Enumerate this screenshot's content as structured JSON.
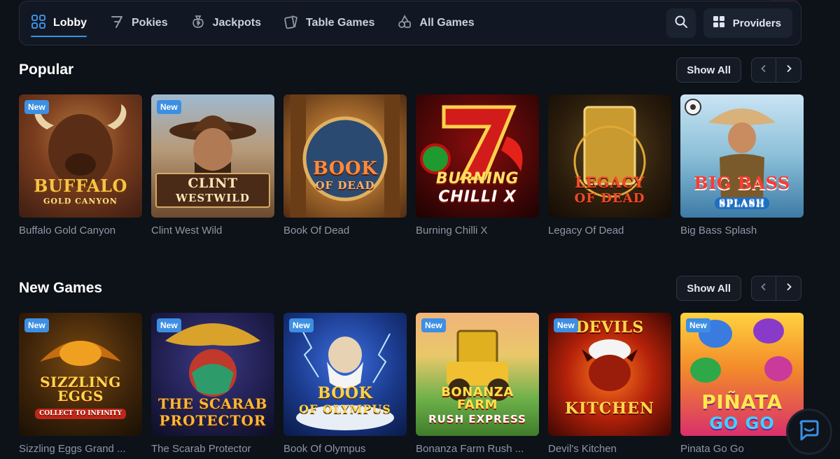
{
  "nav": {
    "tabs": [
      {
        "label": "Lobby",
        "icon": "grid-icon",
        "active": true
      },
      {
        "label": "Pokies",
        "icon": "seven-icon",
        "active": false
      },
      {
        "label": "Jackpots",
        "icon": "money-bag-icon",
        "active": false
      },
      {
        "label": "Table Games",
        "icon": "cards-icon",
        "active": false
      },
      {
        "label": "All Games",
        "icon": "cherries-icon",
        "active": false
      }
    ],
    "search_icon": "search-icon",
    "providers_label": "Providers",
    "providers_icon": "grid-icon"
  },
  "colors": {
    "background": "#0d1118",
    "accent": "#3d8fe3",
    "muted_text": "#8e98a6"
  },
  "sections": [
    {
      "title": "Popular",
      "show_all_label": "Show All",
      "games": [
        {
          "name": "Buffalo Gold Canyon",
          "badge": "New",
          "logo_line1": "BUFFALO",
          "logo_line2": "GOLD CANYON"
        },
        {
          "name": "Clint West Wild",
          "badge": "New",
          "logo_line1": "CLINT",
          "logo_line2": "WESTWILD"
        },
        {
          "name": "Book Of Dead",
          "badge": "",
          "logo_line1": "BOOK",
          "logo_line2": "OF DEAD"
        },
        {
          "name": "Burning Chilli X",
          "badge": "",
          "logo_line1": "BURNING",
          "logo_line2": "CHILLI X"
        },
        {
          "name": "Legacy Of Dead",
          "badge": "",
          "logo_line1": "LEGACY",
          "logo_line2": "OF DEAD"
        },
        {
          "name": "Big Bass Splash",
          "badge": "",
          "logo_line1": "BIG BASS",
          "logo_line2": "SPLASH"
        }
      ]
    },
    {
      "title": "New Games",
      "show_all_label": "Show All",
      "games": [
        {
          "name": "Sizzling Eggs Grand ...",
          "badge": "New",
          "logo_line1": "SIZZLING EGGS",
          "logo_line2": "COLLECT TO INFINITY"
        },
        {
          "name": "The Scarab Protector",
          "badge": "New",
          "logo_line1": "THE SCARAB",
          "logo_line2": "PROTECTOR"
        },
        {
          "name": "Book Of Olympus",
          "badge": "New",
          "logo_line1": "BOOK",
          "logo_line2": "OF OLYMPUS"
        },
        {
          "name": "Bonanza Farm Rush ...",
          "badge": "New",
          "logo_line1": "BONANZA FARM",
          "logo_line2": "RUSH EXPRESS"
        },
        {
          "name": "Devil's Kitchen",
          "badge": "New",
          "logo_line1": "DEVILS",
          "logo_line2": "KITCHEN"
        },
        {
          "name": "Pinata Go Go",
          "badge": "New",
          "logo_line1": "PIÑATA",
          "logo_line2": "GO GO"
        }
      ]
    }
  ]
}
